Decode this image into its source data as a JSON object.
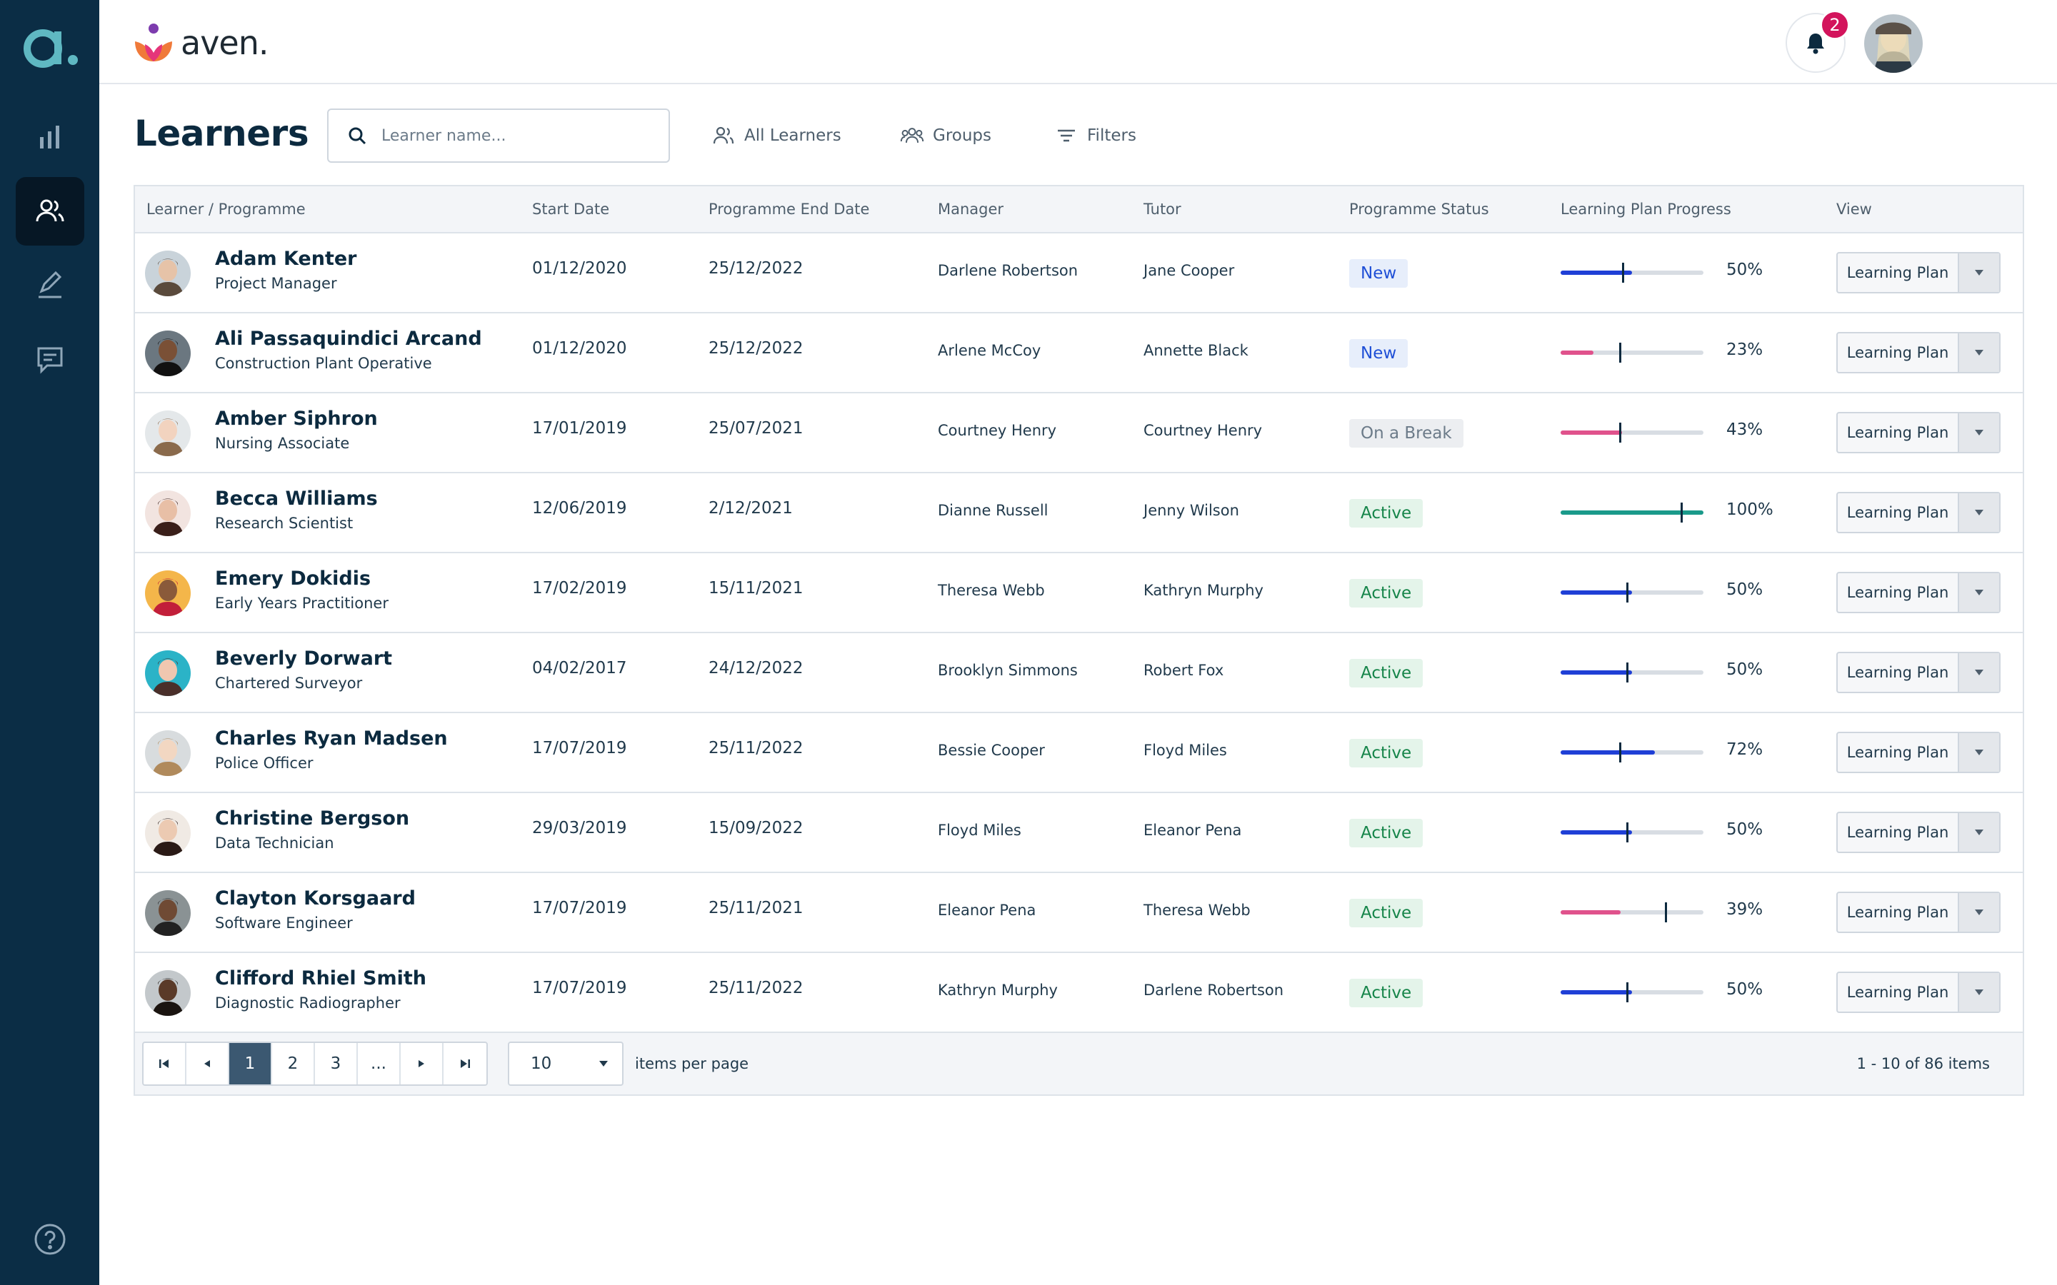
{
  "brand": {
    "name": "aven."
  },
  "topbar": {
    "notification_count": "2"
  },
  "page": {
    "title": "Learners"
  },
  "search": {
    "placeholder": "Learner name..."
  },
  "header_links": {
    "all_learners": "All Learners",
    "groups": "Groups",
    "filters": "Filters"
  },
  "table": {
    "columns": [
      "Learner / Programme",
      "Start Date",
      "Programme End Date",
      "Manager",
      "Tutor",
      "Programme Status",
      "Learning Plan Progress",
      "View"
    ],
    "rows": [
      {
        "name": "Adam Kenter",
        "programme": "Project Manager",
        "start": "01/12/2020",
        "end": "25/12/2022",
        "manager": "Darlene Robertson",
        "tutor": "Jane Cooper",
        "status": "New",
        "status_kind": "new",
        "progress": 50,
        "progress_label": "50%",
        "marker": 43,
        "view": "Learning Plan"
      },
      {
        "name": "Ali Passaquindici Arcand",
        "programme": "Construction Plant Operative",
        "start": "01/12/2020",
        "end": "25/12/2022",
        "manager": "Arlene McCoy",
        "tutor": "Annette Black",
        "status": "New",
        "status_kind": "new",
        "progress": 23,
        "progress_label": "23%",
        "marker": 41,
        "view": "Learning Plan"
      },
      {
        "name": "Amber Siphron",
        "programme": "Nursing Associate",
        "start": "17/01/2019",
        "end": "25/07/2021",
        "manager": "Courtney Henry",
        "tutor": "Courtney Henry",
        "status": "On a Break",
        "status_kind": "break",
        "progress": 43,
        "progress_label": "43%",
        "marker": 41,
        "view": "Learning Plan"
      },
      {
        "name": "Becca Williams",
        "programme": "Research Scientist",
        "start": "12/06/2019",
        "end": "2/12/2021",
        "manager": "Dianne Russell",
        "tutor": "Jenny Wilson",
        "status": "Active",
        "status_kind": "active",
        "progress": 100,
        "progress_label": "100%",
        "marker": 84,
        "view": "Learning Plan"
      },
      {
        "name": "Emery Dokidis",
        "programme": "Early Years Practitioner",
        "start": "17/02/2019",
        "end": "15/11/2021",
        "manager": "Theresa Webb",
        "tutor": "Kathryn Murphy",
        "status": "Active",
        "status_kind": "active",
        "progress": 50,
        "progress_label": "50%",
        "marker": 46,
        "view": "Learning Plan"
      },
      {
        "name": "Beverly Dorwart",
        "programme": "Chartered Surveyor",
        "start": "04/02/2017",
        "end": "24/12/2022",
        "manager": "Brooklyn Simmons",
        "tutor": "Robert Fox",
        "status": "Active",
        "status_kind": "active",
        "progress": 50,
        "progress_label": "50%",
        "marker": 46,
        "view": "Learning Plan"
      },
      {
        "name": "Charles Ryan Madsen",
        "programme": "Police Officer",
        "start": "17/07/2019",
        "end": "25/11/2022",
        "manager": "Bessie Cooper",
        "tutor": "Floyd Miles",
        "status": "Active",
        "status_kind": "active",
        "progress": 66,
        "progress_label": "72%",
        "marker": 41,
        "view": "Learning Plan"
      },
      {
        "name": "Christine Bergson",
        "programme": "Data Technician",
        "start": "29/03/2019",
        "end": "15/09/2022",
        "manager": "Floyd Miles",
        "tutor": "Eleanor Pena",
        "status": "Active",
        "status_kind": "active",
        "progress": 50,
        "progress_label": "50%",
        "marker": 46,
        "view": "Learning Plan"
      },
      {
        "name": "Clayton Korsgaard",
        "programme": "Software Engineer",
        "start": "17/07/2019",
        "end": "25/11/2021",
        "manager": "Eleanor Pena",
        "tutor": "Theresa Webb",
        "status": "Active",
        "status_kind": "active",
        "progress": 42,
        "progress_label": "39%",
        "marker": 73,
        "view": "Learning Plan"
      },
      {
        "name": "Clifford Rhiel Smith",
        "programme": "Diagnostic Radiographer",
        "start": "17/07/2019",
        "end": "25/11/2022",
        "manager": "Kathryn Murphy",
        "tutor": "Darlene Robertson",
        "status": "Active",
        "status_kind": "active",
        "progress": 50,
        "progress_label": "50%",
        "marker": 46,
        "view": "Learning Plan"
      }
    ]
  },
  "pager": {
    "first": "⏮",
    "prev": "◀",
    "pages": [
      "1",
      "2",
      "3",
      "..."
    ],
    "next": "▶",
    "last": "⏭",
    "current": "1",
    "per_page": "10",
    "per_page_label": "items per page",
    "range": "1 - 10 of 86 items"
  },
  "colors": {
    "sidebar": "#0b2d45",
    "progress_on_track": "#1f3fd6",
    "progress_behind": "#e0528c",
    "progress_complete": "#1a9a8a"
  }
}
